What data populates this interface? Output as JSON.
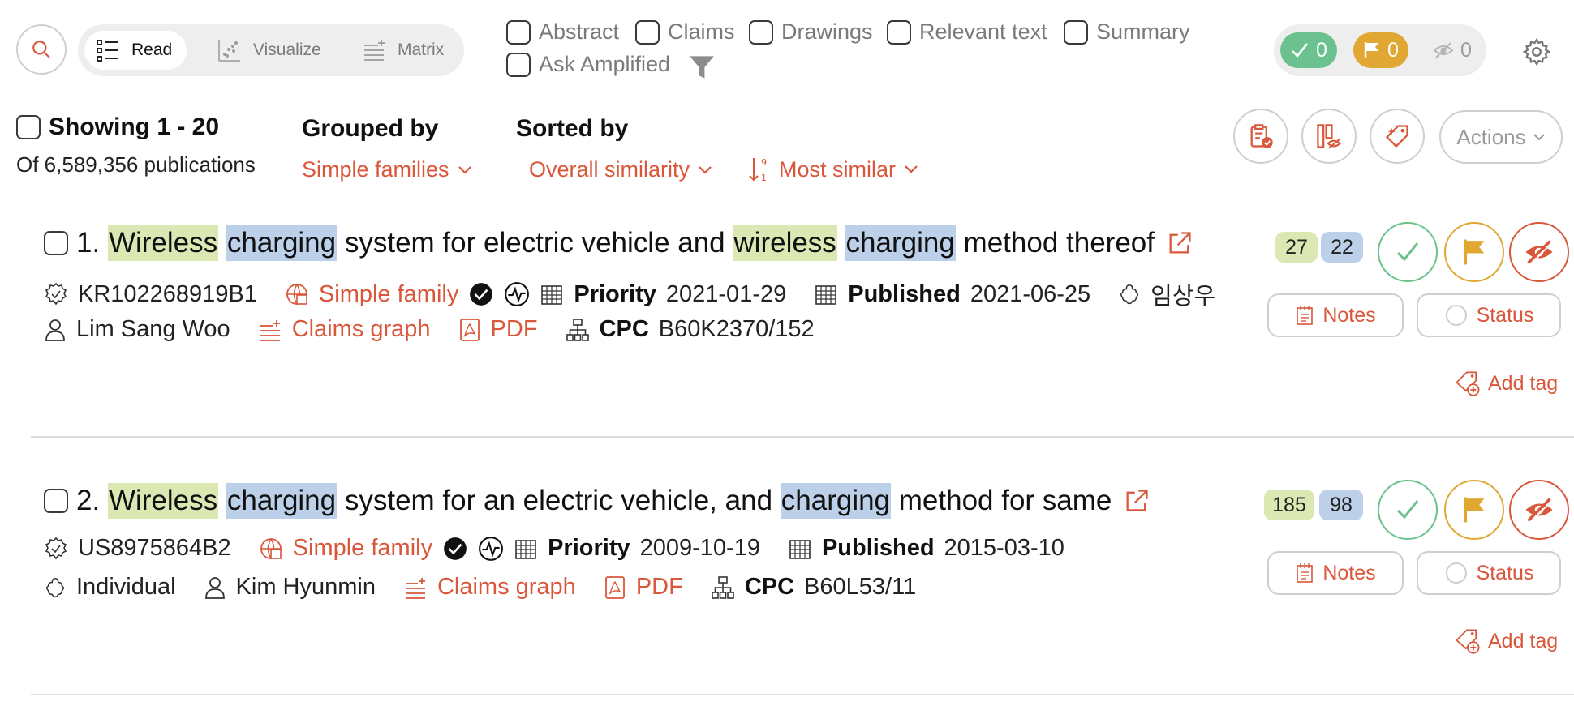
{
  "views": {
    "read": "Read",
    "visualize": "Visualize",
    "matrix": "Matrix"
  },
  "filters": [
    "Abstract",
    "Claims",
    "Drawings",
    "Relevant text",
    "Summary",
    "Ask Amplified"
  ],
  "status_counts": {
    "relevant": "0",
    "flagged": "0",
    "hidden": "0"
  },
  "summary": {
    "showing": "Showing 1 - 20",
    "total": "Of 6,589,356 publications"
  },
  "grouping": {
    "title": "Grouped by",
    "value": "Simple families"
  },
  "sorting": {
    "title": "Sorted by",
    "field": "Overall similarity",
    "order": "Most similar"
  },
  "actions_label": "Actions",
  "results": [
    {
      "index": "1.",
      "title_parts": [
        "Wireless",
        "charging",
        "system for electric vehicle and",
        "wireless",
        "charging",
        "method thereof"
      ],
      "pub_number": "KR102268919B1",
      "family_label": "Simple family",
      "priority_label": "Priority",
      "priority_date": "2021-01-29",
      "published_label": "Published",
      "published_date": "2021-06-25",
      "assignee": "임상우",
      "inventor": "Lim Sang Woo",
      "claims_graph": "Claims graph",
      "pdf": "PDF",
      "cpc_label": "CPC",
      "cpc": "B60K2370/152",
      "score_green": "27",
      "score_blue": "22",
      "notes": "Notes",
      "status": "Status",
      "add_tag": "Add tag"
    },
    {
      "index": "2.",
      "title_parts": [
        "Wireless",
        "charging",
        "system for an electric vehicle, and",
        "charging",
        "method for same"
      ],
      "pub_number": "US8975864B2",
      "family_label": "Simple family",
      "priority_label": "Priority",
      "priority_date": "2009-10-19",
      "published_label": "Published",
      "published_date": "2015-03-10",
      "assignee": "Individual",
      "inventor": "Kim Hyunmin",
      "claims_graph": "Claims graph",
      "pdf": "PDF",
      "cpc_label": "CPC",
      "cpc": "B60L53/11",
      "score_green": "185",
      "score_blue": "98",
      "notes": "Notes",
      "status": "Status",
      "add_tag": "Add tag"
    }
  ],
  "colors": {
    "accent": "#d9573a",
    "relevant": "#6cc28f",
    "flag": "#e0a832",
    "hidden": "#d9573a",
    "highlight_green": "#dce8b3",
    "highlight_blue": "#bcd0ea"
  }
}
